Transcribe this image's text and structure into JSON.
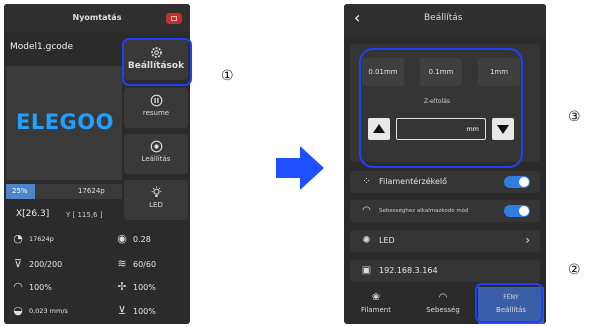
{
  "left": {
    "title": "Nyomtatás",
    "filename": "Model1.gcode",
    "logo": "ELEGOO",
    "side_buttons": [
      {
        "label": "Beállítások",
        "icon": "gear-icon"
      },
      {
        "label": "resume",
        "icon": "pause-icon"
      },
      {
        "label": "Leállítás",
        "icon": "stop-circle-icon"
      },
      {
        "label": "LED",
        "icon": "bulb-icon"
      }
    ],
    "progress": {
      "percent_text": "25%",
      "fraction": 0.25,
      "size": "17624p"
    },
    "coord_x": "X[26.3]",
    "coord_y": "Y [ 115,6 ]",
    "stats": {
      "time": "17624p",
      "layer": "0.28",
      "nozzle": "200/200",
      "bed": "60/60",
      "speed": "100%",
      "fan": "100%",
      "flow": "0,023 mm/s",
      "extrude": "100%"
    }
  },
  "right": {
    "title": "Beállítás",
    "steps": [
      "0.01mm",
      "0.1mm",
      "1mm"
    ],
    "z_label": "Z-eltolás",
    "z_unit": "mm",
    "rows": {
      "filament_sensor": "Filamentérzékelő",
      "speed_mode": "Sebességhez alkalmazkodó mód",
      "led": "LED",
      "ip": "192.168.3.164"
    },
    "tabs": [
      {
        "label": "Filament"
      },
      {
        "label": "Sebesség"
      },
      {
        "label": "Beállítás",
        "top_text": "FÉNY"
      }
    ]
  },
  "annotations": {
    "mark1": "①",
    "mark2": "②",
    "mark3": "③"
  },
  "colors": {
    "accent": "#2f7fe0",
    "arrow": "#1f4fff",
    "highlight": "#1f3fff",
    "logo": "#22a0ff"
  }
}
